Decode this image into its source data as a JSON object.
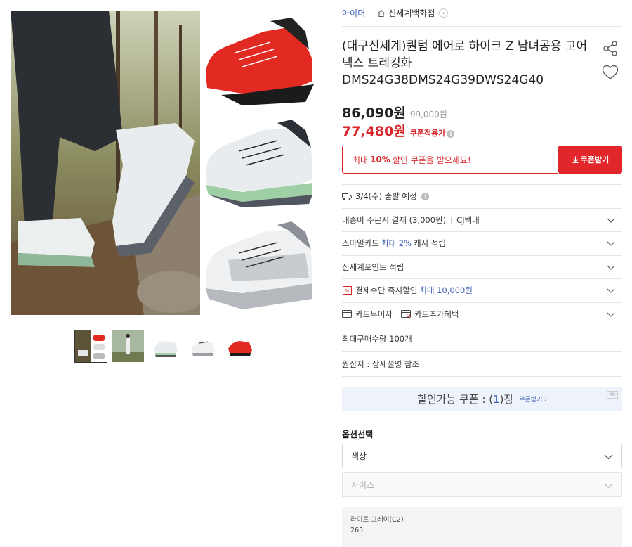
{
  "breadcrumb": {
    "brand": "아이더",
    "store": "신세계백화점"
  },
  "product": {
    "title": "(대구신세계)퀀텀 에어로 하이크 Z 남녀공용 고어텍스 트레킹화 DMS24G38DMS24G39DWS24G40",
    "price": "86,090원",
    "original_price": "99,000원",
    "coupon_price": "77,480원",
    "coupon_note": "쿠폰적용가"
  },
  "coupon_banner": {
    "prefix": "최대",
    "highlight": "10%",
    "suffix": "할인 쿠폰을 받으세요!",
    "button": "쿠폰받기"
  },
  "info_rows": {
    "shipping_date": "3/4(수) 출발 예정",
    "shipping_fee": "배송비 주문시 결제 (3,000원)",
    "carrier": "CJ택배",
    "smile_prefix": "스마일카드",
    "smile_accent": "최대 2%",
    "smile_suffix": "캐시 적립",
    "point": "신세계포인트 적립",
    "instant_prefix": "결제수단 즉시할인",
    "instant_accent": "최대 10,000원",
    "card_interest": "카드무이자",
    "card_benefit": "카드추가혜택",
    "max_qty": "최대구매수량 100개",
    "origin": "원산지 : 상세설명 참조"
  },
  "coupon_count": {
    "prefix": "할인가능 쿠폰 : (",
    "count": "1",
    "suffix": ")장",
    "link": "쿠폰받기 ›",
    "ad": "AD"
  },
  "options": {
    "title": "옵션선택",
    "color_label": "색상",
    "size_label": "사이즈",
    "selected_color": "라이트 그레이(C2)",
    "selected_size": "265"
  },
  "colors": {
    "accent_red": "#e1262c",
    "link_blue": "#3f5fb3",
    "coupon_bg": "#eef3fb"
  },
  "icons": [
    "share-icon",
    "heart-icon",
    "truck-icon",
    "chevron-down-icon",
    "discount-icon",
    "card-icon",
    "download-icon",
    "home-icon"
  ]
}
